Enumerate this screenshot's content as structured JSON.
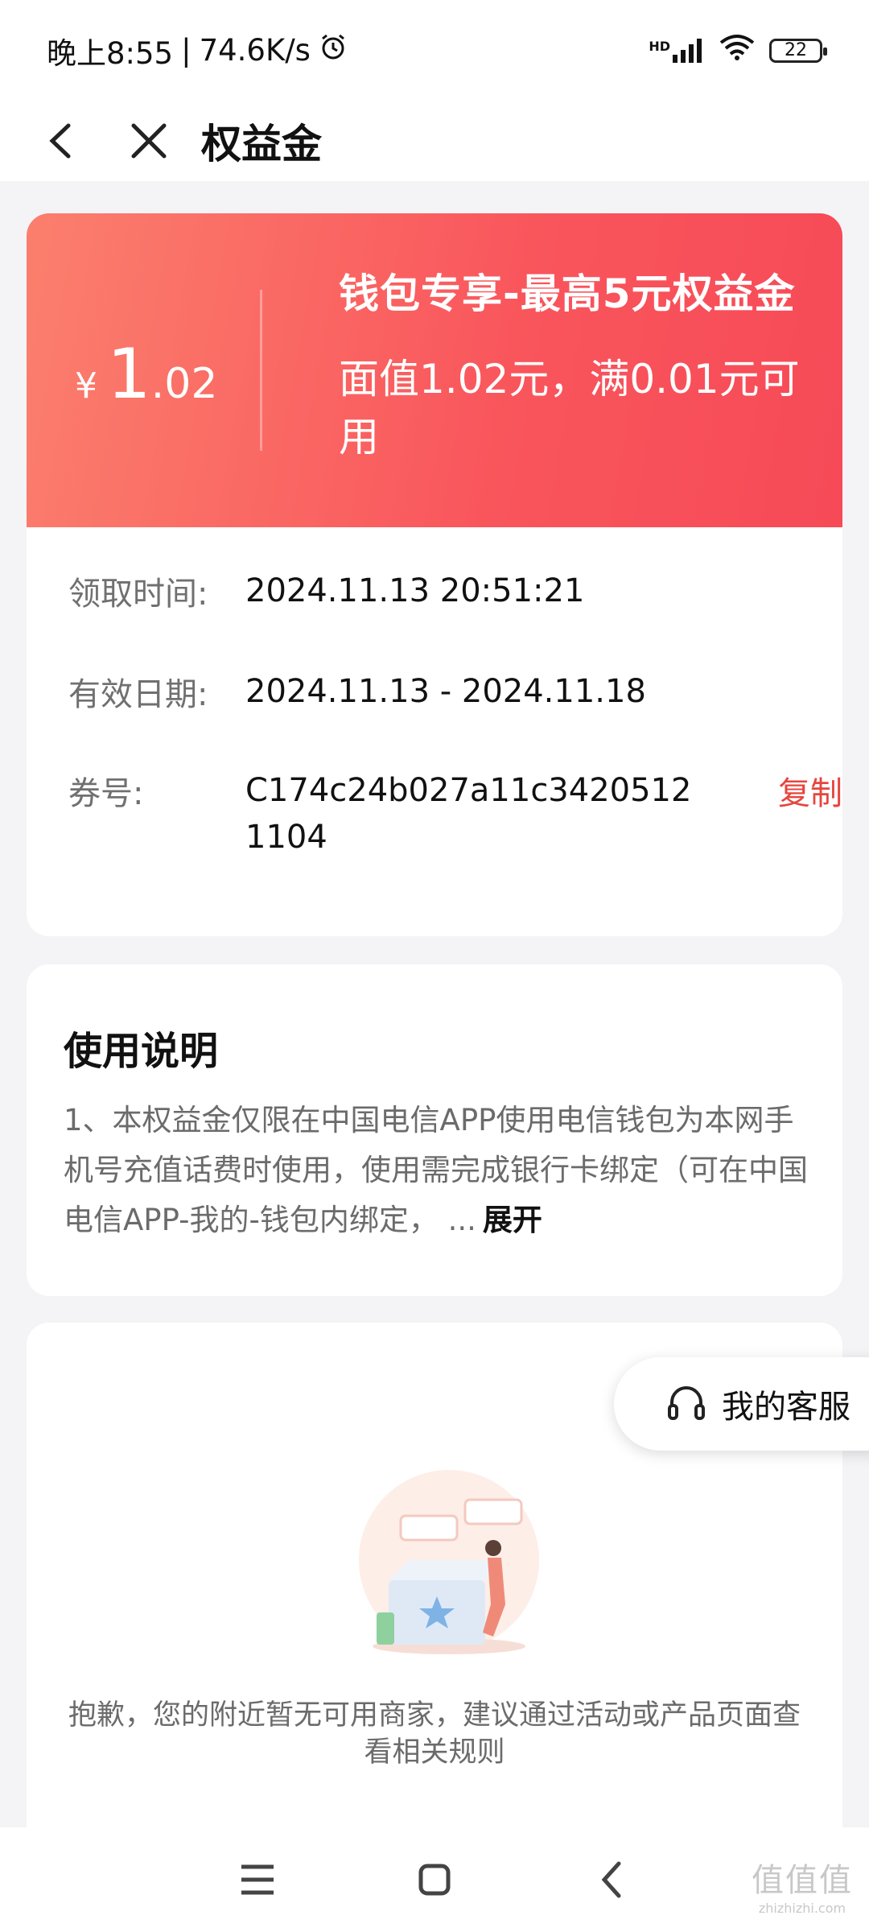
{
  "status_bar": {
    "time": "晚上8:55",
    "separator": "|",
    "speed": "74.6K/s",
    "network": "HD",
    "battery": "22"
  },
  "nav": {
    "title": "权益金"
  },
  "coupon": {
    "currency": "¥",
    "amount_int": "1",
    "amount_dec": ".02",
    "title": "钱包专享-最高5元权益金",
    "description": "面值1.02元，满0.01元可用",
    "rows": [
      {
        "label": "领取时间:",
        "value": "2024.11.13 20:51:21"
      },
      {
        "label": "有效日期:",
        "value": "2024.11.13 - 2024.11.18"
      },
      {
        "label": "券号:",
        "value": "C174c24b027a11c34205121104"
      }
    ],
    "copy_label": "复制"
  },
  "usage": {
    "title": "使用说明",
    "body": "1、本权益金仅限在中国电信APP使用电信钱包为本网手机号充值话费时使用，使用需完成银行卡绑定（可在中国电信APP-我的-钱包内绑定， ...",
    "expand_label": "展开"
  },
  "merchants": {
    "empty_text": "抱歉，您的附近暂无可用商家，建议通过活动或产品页面查看相关规则"
  },
  "customer_service": {
    "label": "我的客服"
  },
  "watermark": {
    "logo": "值值值",
    "url": "zhizhizhi.com"
  },
  "colors": {
    "accent_red": "#f9555c",
    "copy_red": "#e6453f"
  }
}
